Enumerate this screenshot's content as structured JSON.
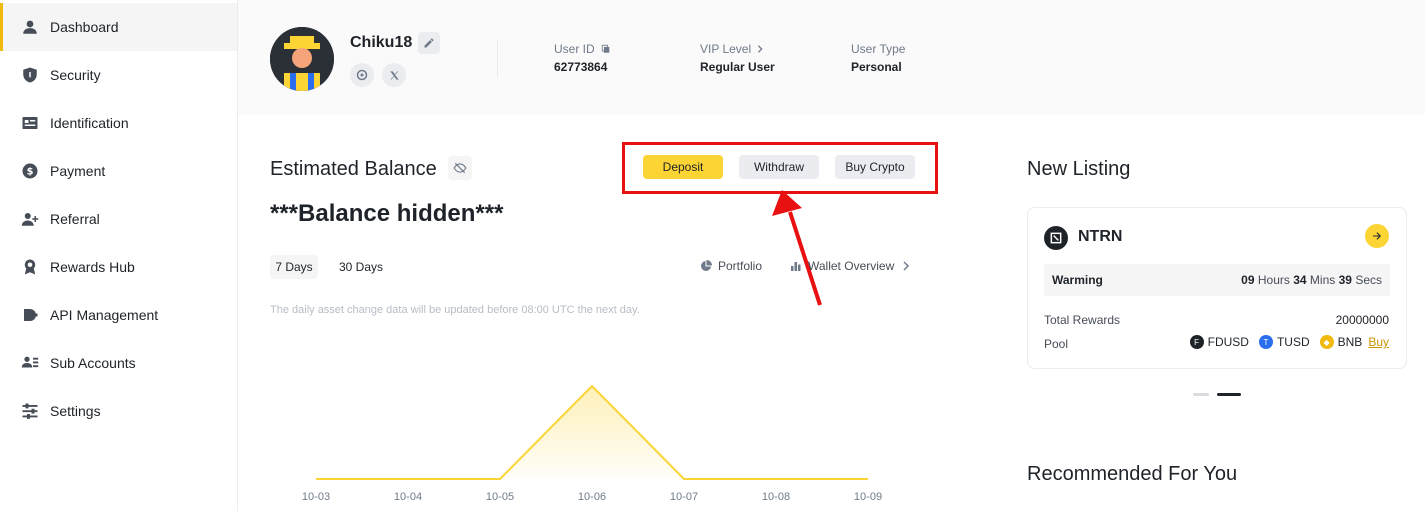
{
  "sidebar": {
    "items": [
      {
        "label": "Dashboard",
        "icon": "user-icon",
        "active": true
      },
      {
        "label": "Security",
        "icon": "shield-icon"
      },
      {
        "label": "Identification",
        "icon": "id-card-icon"
      },
      {
        "label": "Payment",
        "icon": "dollar-icon"
      },
      {
        "label": "Referral",
        "icon": "add-user-icon"
      },
      {
        "label": "Rewards Hub",
        "icon": "medal-icon"
      },
      {
        "label": "API Management",
        "icon": "api-icon"
      },
      {
        "label": "Sub Accounts",
        "icon": "sub-accounts-icon"
      },
      {
        "label": "Settings",
        "icon": "sliders-icon"
      }
    ]
  },
  "profile": {
    "username": "Chiku18",
    "user_id_label": "User ID",
    "user_id": "62773864",
    "vip_label": "VIP Level",
    "vip_value": "Regular User",
    "user_type_label": "User Type",
    "user_type_value": "Personal"
  },
  "balance": {
    "title": "Estimated Balance",
    "value": "***Balance hidden***",
    "deposit_label": "Deposit",
    "withdraw_label": "Withdraw",
    "buy_label": "Buy Crypto",
    "tab_7": "7 Days",
    "tab_30": "30 Days",
    "portfolio_label": "Portfolio",
    "wallet_label": "Wallet Overview",
    "note": "The daily asset change data will be updated before 08:00 UTC the next day."
  },
  "chart_data": {
    "type": "area",
    "categories": [
      "10-03",
      "10-04",
      "10-05",
      "10-06",
      "10-07",
      "10-08",
      "10-09"
    ],
    "values": [
      0,
      0,
      0,
      1,
      0,
      0,
      0
    ],
    "title": "",
    "xlabel": "",
    "ylabel": "",
    "ylim": [
      0,
      1
    ],
    "grid": false,
    "color": "#fcd535"
  },
  "new_listing": {
    "title": "New Listing",
    "coin": "NTRN",
    "warming_label": "Warming",
    "hours": "09",
    "hours_unit": "Hours",
    "mins": "34",
    "mins_unit": "Mins",
    "secs": "39",
    "secs_unit": "Secs",
    "total_rewards_label": "Total Rewards",
    "total_rewards_value": "20000000",
    "pool_label": "Pool",
    "pool_coins": [
      {
        "name": "FDUSD",
        "color": "#1e2329"
      },
      {
        "name": "TUSD",
        "color": "#2b6def"
      },
      {
        "name": "BNB",
        "color": "#f0b90b"
      }
    ],
    "buy_label": "Buy"
  },
  "recommended": {
    "title": "Recommended For You"
  },
  "colors": {
    "accent": "#fcd535",
    "highlight": "#e81010"
  }
}
